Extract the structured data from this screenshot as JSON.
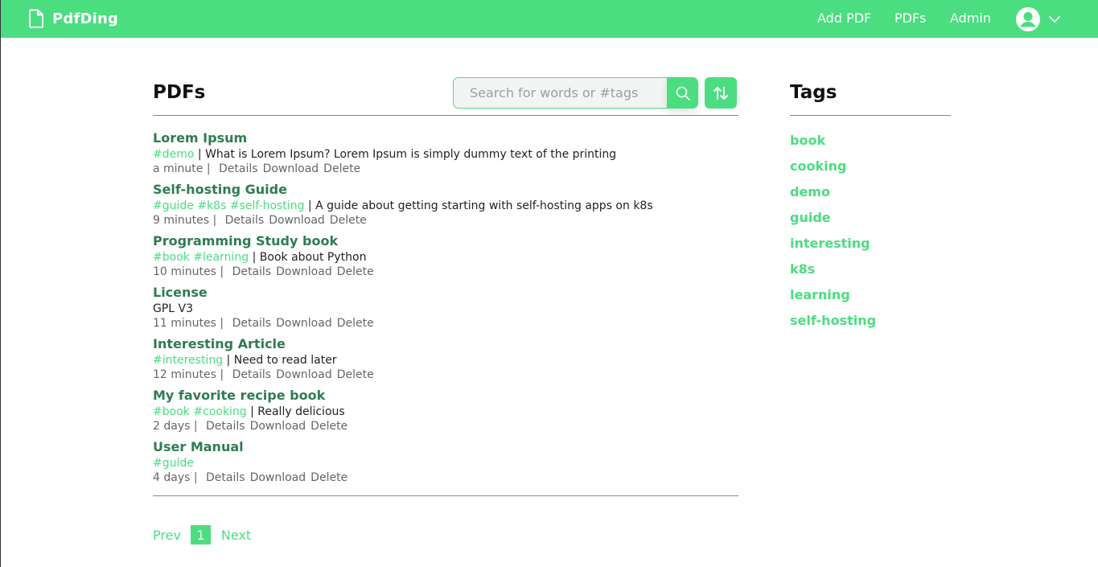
{
  "app": {
    "name": "PdfDing"
  },
  "nav": {
    "links": [
      "Add PDF",
      "PDFs",
      "Admin"
    ]
  },
  "main": {
    "title": "PDFs",
    "search_placeholder": "Search for words or #tags",
    "pdfs": [
      {
        "title": "Lorem Ipsum",
        "tags": [
          "#demo"
        ],
        "description": "What is Lorem Ipsum? Lorem Ipsum is simply dummy text of the printing",
        "age": "a minute"
      },
      {
        "title": "Self-hosting Guide",
        "tags": [
          "#guide",
          "#k8s",
          "#self-hosting"
        ],
        "description": "A guide about getting starting with self-hosting apps on k8s",
        "age": "9 minutes"
      },
      {
        "title": "Programming Study book",
        "tags": [
          "#book",
          "#learning"
        ],
        "description": "Book about Python",
        "age": "10 minutes"
      },
      {
        "title": "License",
        "tags": [],
        "description": "GPL V3",
        "age": "11 minutes"
      },
      {
        "title": "Interesting Article",
        "tags": [
          "#interesting"
        ],
        "description": "Need to read later",
        "age": "12 minutes"
      },
      {
        "title": "My favorite recipe book",
        "tags": [
          "#book",
          "#cooking"
        ],
        "description": "Really delicious",
        "age": "2 days"
      },
      {
        "title": "User Manual",
        "tags": [
          "#guide"
        ],
        "description": "",
        "age": "4 days"
      }
    ],
    "actions": [
      "Details",
      "Download",
      "Delete"
    ],
    "pagination": {
      "prev": "Prev",
      "current": "1",
      "next": "Next"
    }
  },
  "sidebar": {
    "title": "Tags",
    "tags": [
      "book",
      "cooking",
      "demo",
      "guide",
      "interesting",
      "k8s",
      "learning",
      "self-hosting"
    ]
  },
  "colors": {
    "accent": "#4ade80",
    "title_green": "#2e7d4f"
  }
}
